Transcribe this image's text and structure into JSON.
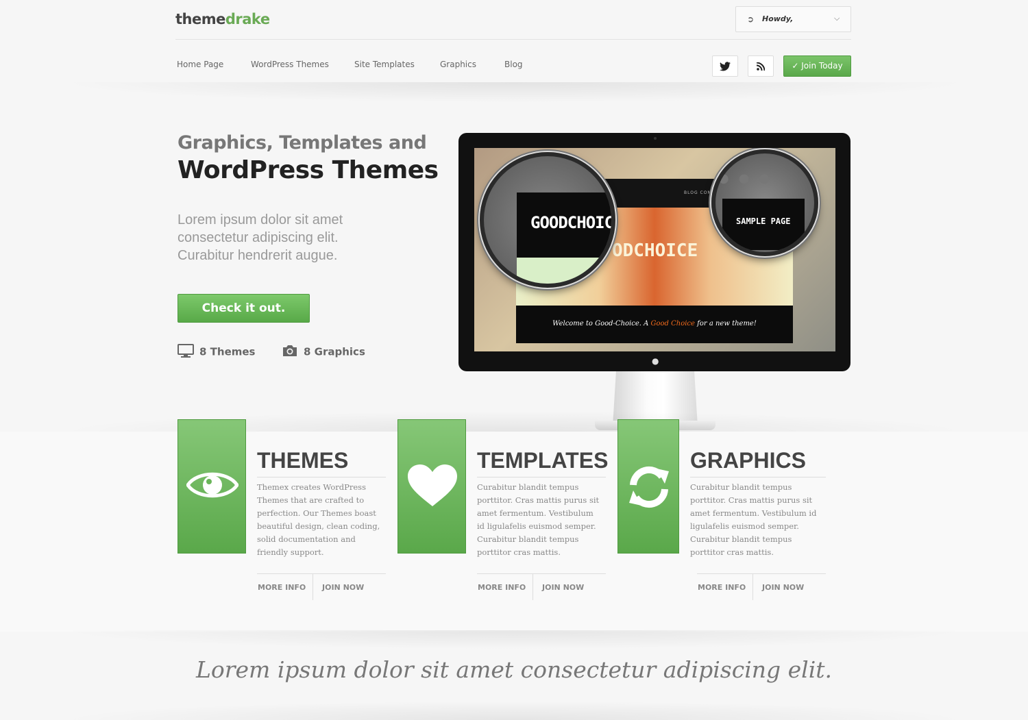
{
  "header": {
    "logo_part1": "theme",
    "logo_part2": "drake",
    "user_menu": {
      "label": "Howdy,",
      "icon": "sign-in-icon"
    },
    "nav": [
      "Home Page",
      "WordPress Themes",
      "Site Templates",
      "Graphics",
      "Blog"
    ],
    "social": [
      "twitter-icon",
      "rss-icon"
    ],
    "join_label": "Join Today"
  },
  "hero": {
    "title_line1": "Graphics, Templates and",
    "title_line2": "WordPress Themes",
    "lead": "Lorem ipsum dolor sit amet consectetur adipiscing elit. Curabitur hendrerit augue.",
    "cta": "Check it out.",
    "stats": [
      {
        "icon": "monitor-icon",
        "label": "8 Themes"
      },
      {
        "icon": "camera-icon",
        "label": "8 Graphics"
      }
    ],
    "screen": {
      "nav": "BLOG   CONTACT",
      "lens_left": "GOODCHOIC",
      "lens_right": "SAMPLE PAGE",
      "hero_text": "ODCHOICE",
      "welcome_pre": "Welcome to Good-Choice. A ",
      "welcome_hl": "Good Choice",
      "welcome_post": " for a new theme!"
    }
  },
  "features": [
    {
      "icon": "eye-icon",
      "title": "THEMES",
      "desc": "Themex creates WordPress Themes that are crafted to perfection. Our Themes boast beautiful design, clean coding, solid documentation and friendly support.",
      "more": "MORE INFO",
      "join": "JOIN NOW"
    },
    {
      "icon": "heart-icon",
      "title": "TEMPLATES",
      "desc": "Curabitur blandit tempus porttitor. Cras mattis purus sit amet fermentum. Vestibulum id ligulafelis euismod semper. Curabitur blandit tempus porttitor cras mattis.",
      "more": "MORE INFO",
      "join": "JOIN NOW"
    },
    {
      "icon": "refresh-icon",
      "title": "GRAPHICS",
      "desc": "Curabitur blandit tempus porttitor. Cras mattis purus sit amet fermentum. Vestibulum id ligulafelis euismod semper. Curabitur blandit tempus porttitor cras mattis.",
      "more": "MORE INFO",
      "join": "JOIN NOW"
    }
  ],
  "quote": "Lorem ipsum dolor sit amet consectetur adipiscing elit.",
  "colors": {
    "accent": "#5aa84a",
    "dark": "#222222"
  }
}
